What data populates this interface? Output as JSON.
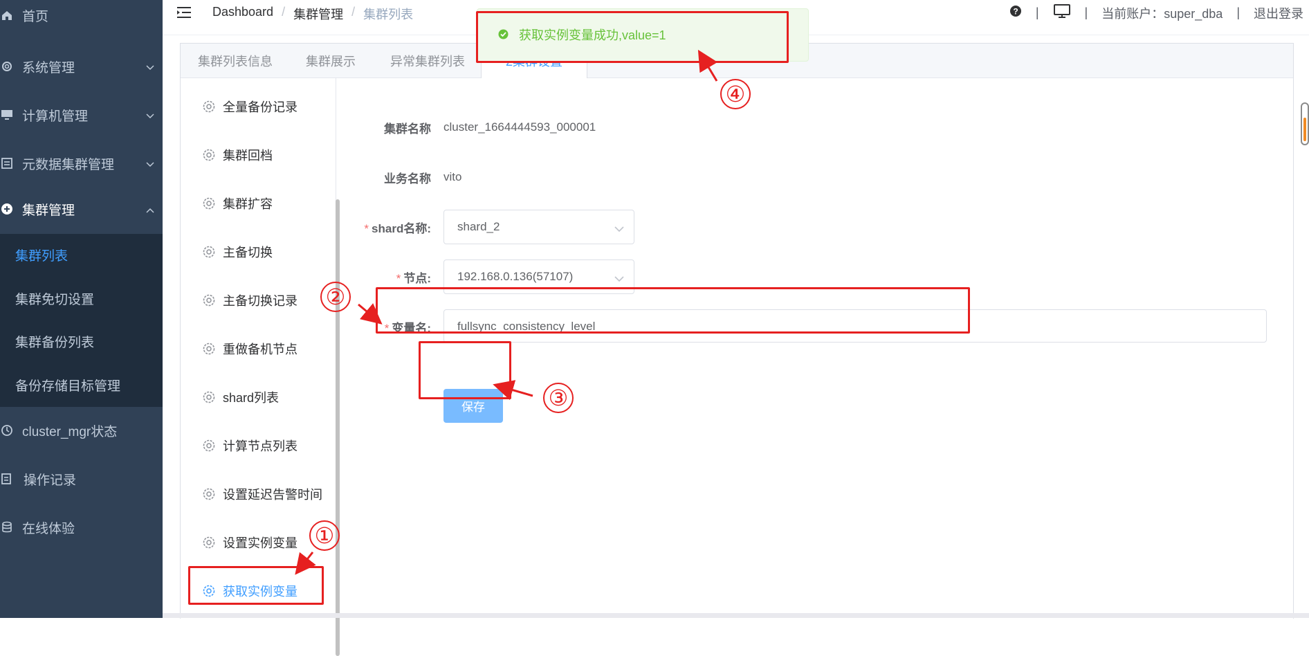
{
  "sidebar": {
    "items": [
      {
        "label": "首页",
        "icon": "home-icon"
      },
      {
        "label": "系统管理",
        "icon": "gear-icon"
      },
      {
        "label": "计算机管理",
        "icon": "monitor-icon"
      },
      {
        "label": "元数据集群管理",
        "icon": "metadata-icon"
      },
      {
        "label": "集群管理",
        "icon": "cluster-icon"
      },
      {
        "label": "cluster_mgr状态",
        "icon": "status-icon"
      },
      {
        "label": "操作记录",
        "icon": "log-icon"
      },
      {
        "label": "在线体验",
        "icon": "database-icon"
      }
    ],
    "submenu": [
      {
        "label": "集群列表"
      },
      {
        "label": "集群免切设置"
      },
      {
        "label": "集群备份列表"
      },
      {
        "label": "备份存储目标管理"
      }
    ]
  },
  "header": {
    "breadcrumb": [
      "Dashboard",
      "集群管理",
      "集群列表"
    ],
    "separator": "/",
    "account_label": "当前账户：super_dba",
    "logout_label": "退出登录",
    "pipe": "|"
  },
  "tabs": [
    "集群列表信息",
    "集群展示",
    "异常集群列表",
    "2集群设置"
  ],
  "left_menu": [
    "全量备份记录",
    "集群回档",
    "集群扩容",
    "主备切换",
    "主备切换记录",
    "重做备机节点",
    "shard列表",
    "计算节点列表",
    "设置延迟告警时间",
    "设置实例变量",
    "获取实例变量"
  ],
  "form": {
    "cluster_name_label": "集群名称",
    "cluster_name_value": "cluster_1664444593_000001",
    "business_name_label": "业务名称",
    "business_name_value": "vito",
    "shard_label": "shard名称:",
    "shard_value": "shard_2",
    "node_label": "节点:",
    "node_value": "192.168.0.136(57107)",
    "var_label": "变量名:",
    "var_value": "fullsync_consistency_level",
    "required_mark": "*",
    "save_label": "保存"
  },
  "toast": {
    "message": "获取实例变量成功,value=1",
    "type": "success"
  },
  "annotations": [
    "①",
    "②",
    "③",
    "④"
  ],
  "colors": {
    "sidebar_bg": "#304156",
    "submenu_bg": "#1f2d3d",
    "accent": "#409eff",
    "success": "#67c23a",
    "annotation": "#e62020"
  }
}
